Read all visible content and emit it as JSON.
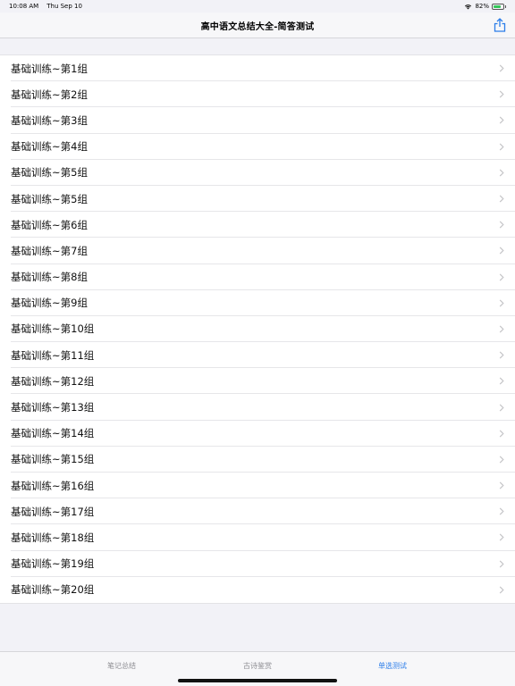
{
  "status": {
    "time": "10:08 AM",
    "date": "Thu Sep 10",
    "battery": "82%",
    "battery_level": 0.82
  },
  "nav": {
    "title": "高中语文总结大全-简答测试"
  },
  "list": {
    "items": [
      "基础训练~第1组",
      "基础训练~第2组",
      "基础训练~第3组",
      "基础训练~第4组",
      "基础训练~第5组",
      "基础训练~第5组",
      "基础训练~第6组",
      "基础训练~第7组",
      "基础训练~第8组",
      "基础训练~第9组",
      "基础训练~第10组",
      "基础训练~第11组",
      "基础训练~第12组",
      "基础训练~第13组",
      "基础训练~第14组",
      "基础训练~第15组",
      "基础训练~第16组",
      "基础训练~第17组",
      "基础训练~第18组",
      "基础训练~第19组",
      "基础训练~第20组"
    ]
  },
  "tabs": [
    {
      "label": "笔记总结",
      "active": false
    },
    {
      "label": "古诗鉴赏",
      "active": false
    },
    {
      "label": "单选测试",
      "active": true
    }
  ],
  "colors": {
    "accent": "#2b7de9",
    "battery": "#34c759"
  }
}
